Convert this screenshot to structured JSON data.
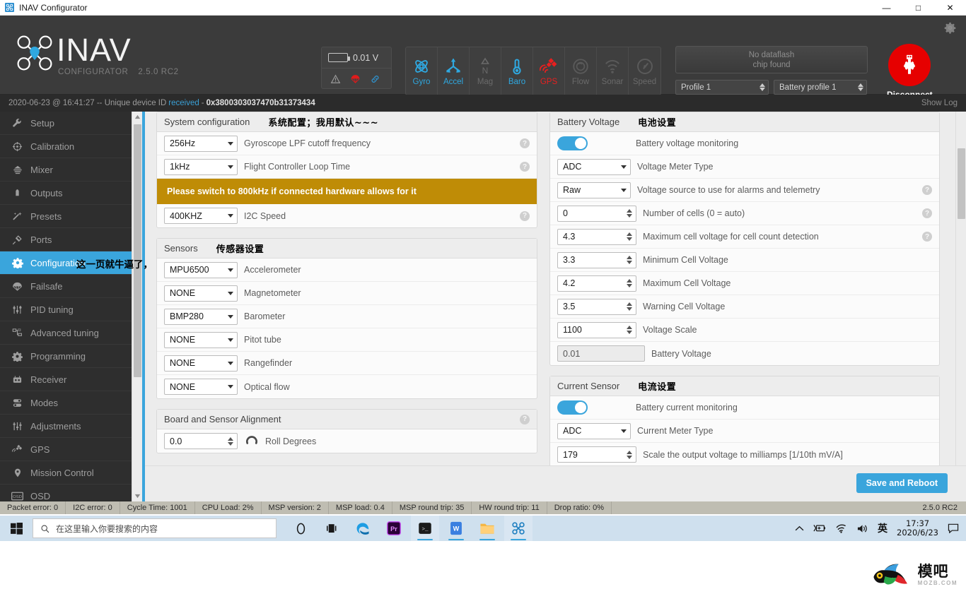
{
  "window": {
    "title": "INAV Configurator",
    "minimize": "—",
    "maximize": "□",
    "close": "✕"
  },
  "header": {
    "logo_word": "INAV",
    "logo_sub_1": "CONFIGURATOR",
    "logo_sub_2": "2.5.0 RC2",
    "battery_voltage": "0.01 V",
    "dataflash_line1": "No dataflash",
    "dataflash_line2": "chip found",
    "profile": "Profile 1",
    "battery_profile": "Battery profile 1",
    "disconnect_label": "Disconnect",
    "sensors": [
      {
        "name": "Gyro",
        "state": "on"
      },
      {
        "name": "Accel",
        "state": "on"
      },
      {
        "name": "Mag",
        "state": "off"
      },
      {
        "name": "Baro",
        "state": "on"
      },
      {
        "name": "GPS",
        "state": "err"
      },
      {
        "name": "Flow",
        "state": "off"
      },
      {
        "name": "Sonar",
        "state": "off"
      },
      {
        "name": "Speed",
        "state": "off"
      }
    ]
  },
  "logline": {
    "timestamp": "2020-06-23 @ 16:41:27 -- Unique device ID",
    "status": "received",
    "dash": "-",
    "device_id": "0x3800303037470b31373434",
    "show_log": "Show Log"
  },
  "sidebar": {
    "items": [
      {
        "label": "Setup",
        "icon": "wrench-icon",
        "active": false
      },
      {
        "label": "Calibration",
        "icon": "crosshair-icon",
        "active": false
      },
      {
        "label": "Mixer",
        "icon": "mixer-icon",
        "active": false
      },
      {
        "label": "Outputs",
        "icon": "motor-icon",
        "active": false
      },
      {
        "label": "Presets",
        "icon": "wand-icon",
        "active": false
      },
      {
        "label": "Ports",
        "icon": "plug-icon",
        "active": false
      },
      {
        "label": "Configuration",
        "icon": "gear-icon",
        "active": true
      },
      {
        "label": "Failsafe",
        "icon": "parachute-icon",
        "active": false
      },
      {
        "label": "PID tuning",
        "icon": "sliders-icon",
        "active": false
      },
      {
        "label": "Advanced tuning",
        "icon": "hierarchy-icon",
        "active": false
      },
      {
        "label": "Programming",
        "icon": "gear-icon",
        "active": false
      },
      {
        "label": "Receiver",
        "icon": "transmitter-icon",
        "active": false
      },
      {
        "label": "Modes",
        "icon": "switches-icon",
        "active": false
      },
      {
        "label": "Adjustments",
        "icon": "faders-icon",
        "active": false
      },
      {
        "label": "GPS",
        "icon": "satellite-icon",
        "active": false
      },
      {
        "label": "Mission Control",
        "icon": "pin-icon",
        "active": false
      },
      {
        "label": "OSD",
        "icon": "osd-icon",
        "active": false
      }
    ]
  },
  "annotations": {
    "configuration_note": "这一页就牛逼了，",
    "system_note": "系统配置；我用默认~~~",
    "sensors_note": "传感器设置",
    "battery_note": "电池设置",
    "current_note": "电流设置"
  },
  "system_configuration": {
    "title": "System configuration",
    "rows": [
      {
        "value": "256Hz",
        "label": "Gyroscope LPF cutoff frequency",
        "hint": true
      },
      {
        "value": "1kHz",
        "label": "Flight Controller Loop Time",
        "hint": true
      }
    ],
    "warning": "Please switch to 800kHz if connected hardware allows for it",
    "i2c": {
      "value": "400KHZ",
      "label": "I2C Speed",
      "hint": true
    }
  },
  "sensors_panel": {
    "title": "Sensors",
    "rows": [
      {
        "value": "MPU6500",
        "label": "Accelerometer"
      },
      {
        "value": "NONE",
        "label": "Magnetometer"
      },
      {
        "value": "BMP280",
        "label": "Barometer"
      },
      {
        "value": "NONE",
        "label": "Pitot tube"
      },
      {
        "value": "NONE",
        "label": "Rangefinder"
      },
      {
        "value": "NONE",
        "label": "Optical flow"
      }
    ]
  },
  "alignment_panel": {
    "title": "Board and Sensor Alignment",
    "row": {
      "value": "0.0",
      "label": "Roll Degrees"
    }
  },
  "battery_voltage_panel": {
    "title": "Battery Voltage",
    "toggle_label": "Battery voltage monitoring",
    "toggle_on": true,
    "rows": [
      {
        "type": "select",
        "value": "ADC",
        "label": "Voltage Meter Type",
        "hint": false
      },
      {
        "type": "select",
        "value": "Raw",
        "label": "Voltage source to use for alarms and telemetry",
        "hint": true
      },
      {
        "type": "number",
        "value": "0",
        "label": "Number of cells (0 = auto)",
        "hint": true
      },
      {
        "type": "number",
        "value": "4.3",
        "label": "Maximum cell voltage for cell count detection",
        "hint": true
      },
      {
        "type": "number",
        "value": "3.3",
        "label": "Minimum Cell Voltage",
        "hint": false
      },
      {
        "type": "number",
        "value": "4.2",
        "label": "Maximum Cell Voltage",
        "hint": false
      },
      {
        "type": "number",
        "value": "3.5",
        "label": "Warning Cell Voltage",
        "hint": false
      },
      {
        "type": "number",
        "value": "1100",
        "label": "Voltage Scale",
        "hint": false
      },
      {
        "type": "readonly",
        "value": "0.01",
        "label": "Battery Voltage",
        "hint": false
      }
    ]
  },
  "current_sensor_panel": {
    "title": "Current Sensor",
    "toggle_label": "Battery current monitoring",
    "toggle_on": true,
    "rows": [
      {
        "type": "select",
        "value": "ADC",
        "label": "Current Meter Type"
      },
      {
        "type": "number",
        "value": "179",
        "label": "Scale the output voltage to milliamps [1/10th mV/A]"
      }
    ]
  },
  "save_bar": {
    "button": "Save and Reboot"
  },
  "status_bar": {
    "cells": [
      "Packet error: 0",
      "I2C error: 0",
      "Cycle Time: 1001",
      "CPU Load: 2%",
      "MSP version: 2",
      "MSP load: 0.4",
      "MSP round trip: 35",
      "HW round trip: 11",
      "Drop ratio: 0%"
    ],
    "version": "2.5.0 RC2"
  },
  "taskbar": {
    "search_placeholder": "在这里输入你要搜索的内容",
    "ime": "英",
    "time": "17:37",
    "date": "2020/6/23"
  },
  "watermark": {
    "cn": "模吧",
    "en": "MOZB.COM"
  },
  "colors": {
    "accent": "#3aa5dc",
    "warning": "#bf8c06",
    "danger": "#e60000",
    "header_bg": "#3b3b3b",
    "sidebar_bg": "#2e2e2e"
  }
}
